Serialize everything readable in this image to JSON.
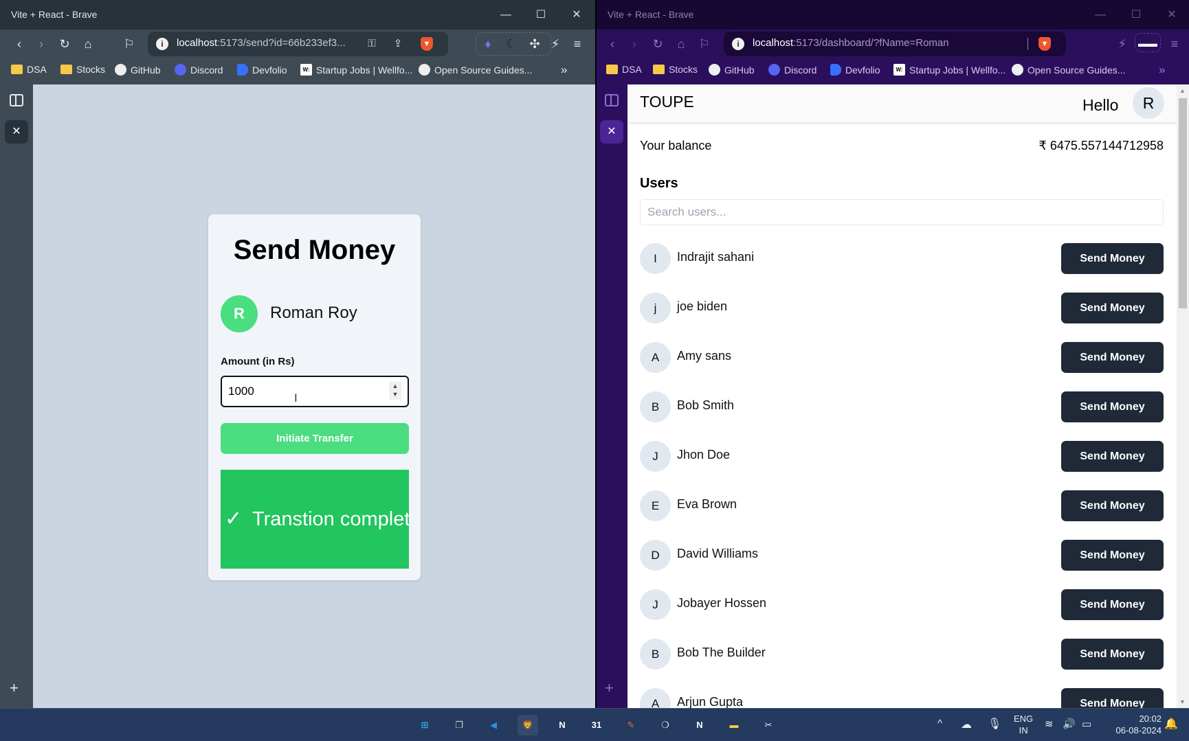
{
  "left_window": {
    "title": "Vite + React - Brave",
    "controls": {
      "minimize": "—",
      "maximize": "☐",
      "close": "✕"
    },
    "url_host": "localhost",
    "url_rest": ":5173/send?id=66b233ef3...",
    "bookmarks": [
      {
        "label": "DSA",
        "icon": "folder-icon"
      },
      {
        "label": "Stocks",
        "icon": "folder-icon"
      },
      {
        "label": "GitHub",
        "icon": "github-icon"
      },
      {
        "label": "Discord",
        "icon": "discord-icon"
      },
      {
        "label": "Devfolio",
        "icon": "devfolio-icon"
      },
      {
        "label": "Startup Jobs | Wellfo...",
        "icon": "wellfound-icon"
      },
      {
        "label": "Open Source Guides...",
        "icon": "github-icon"
      }
    ],
    "bookmarks_more": "»",
    "send_card": {
      "title": "Send Money",
      "recipient_initial": "R",
      "recipient_name": "Roman Roy",
      "amount_label": "Amount (in Rs)",
      "amount_value": "1000",
      "transfer_button": "Initiate Transfer",
      "success_message": "Transtion complete",
      "success_icon": "✓"
    }
  },
  "right_window": {
    "title": "Vite + React - Brave",
    "controls": {
      "minimize": "—",
      "maximize": "☐",
      "close": "✕"
    },
    "url_host": "localhost",
    "url_rest": ":5173/dashboard/?fName=Roman",
    "bookmarks": [
      {
        "label": "DSA",
        "icon": "folder-icon"
      },
      {
        "label": "Stocks",
        "icon": "folder-icon"
      },
      {
        "label": "GitHub",
        "icon": "github-icon"
      },
      {
        "label": "Discord",
        "icon": "discord-icon"
      },
      {
        "label": "Devfolio",
        "icon": "devfolio-icon"
      },
      {
        "label": "Startup Jobs | Wellfo...",
        "icon": "wellfound-icon"
      },
      {
        "label": "Open Source Guides...",
        "icon": "github-icon"
      }
    ],
    "bookmarks_more": "»",
    "app": {
      "brand": "TOUPE",
      "greeting": "Hello",
      "user_initial": "R",
      "balance_label": "Your balance",
      "balance_value": "₹ 6475.557144712958",
      "users_heading": "Users",
      "search_placeholder": "Search users...",
      "send_button_label": "Send Money",
      "users": [
        {
          "initial": "I",
          "name": "Indrajit sahani"
        },
        {
          "initial": "j",
          "name": "joe biden"
        },
        {
          "initial": "A",
          "name": "Amy sans"
        },
        {
          "initial": "B",
          "name": "Bob Smith"
        },
        {
          "initial": "J",
          "name": "Jhon Doe"
        },
        {
          "initial": "E",
          "name": "Eva Brown"
        },
        {
          "initial": "D",
          "name": "David Williams"
        },
        {
          "initial": "J",
          "name": "Jobayer Hossen"
        },
        {
          "initial": "B",
          "name": "Bob The Builder"
        },
        {
          "initial": "A",
          "name": "Arjun Gupta"
        }
      ]
    }
  },
  "taskbar": {
    "apps": [
      {
        "name": "start",
        "glyph": "⊞",
        "color": "#3aa8f0"
      },
      {
        "name": "task-view",
        "glyph": "❐",
        "color": "#d0d4d8"
      },
      {
        "name": "vscode",
        "glyph": "◀",
        "color": "#2f8fe0"
      },
      {
        "name": "brave",
        "glyph": "🦁",
        "color": "#f0562b"
      },
      {
        "name": "notion",
        "glyph": "N",
        "color": "#ffffff"
      },
      {
        "name": "calendar",
        "glyph": "31",
        "color": "#ffffff"
      },
      {
        "name": "postman",
        "glyph": "✎",
        "color": "#ef6b33"
      },
      {
        "name": "mongodb-compass",
        "glyph": "❍",
        "color": "#ffffff"
      },
      {
        "name": "notion-2",
        "glyph": "N",
        "color": "#ffffff"
      },
      {
        "name": "file-explorer",
        "glyph": "▬",
        "color": "#f7c949"
      },
      {
        "name": "snipping-tool",
        "glyph": "✂",
        "color": "#e0e6ee"
      }
    ],
    "tray": {
      "chevron": "^",
      "language_top": "ENG",
      "language_bottom": "IN",
      "time": "20:02",
      "date": "06-08-2024"
    }
  }
}
